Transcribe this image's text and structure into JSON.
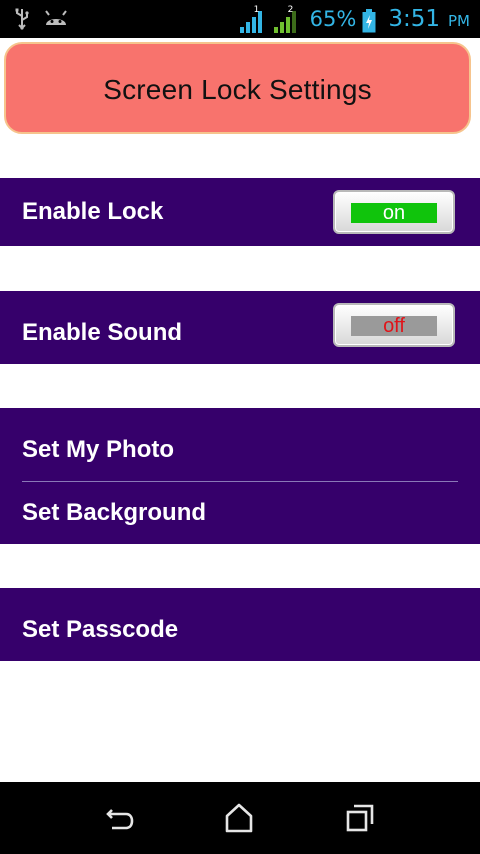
{
  "status_bar": {
    "icons_left": [
      "usb-icon",
      "android-debug-icon"
    ],
    "sim1_label": "1",
    "sim2_label": "2",
    "battery_percent": "65%",
    "time": "3:51",
    "ampm": "PM",
    "colors": {
      "accent": "#33b5e5",
      "sim2_signal": "#6fbf2f"
    }
  },
  "header": {
    "title": "Screen Lock Settings",
    "colors": {
      "background": "#f8736d",
      "border": "#f6c48d"
    }
  },
  "settings": {
    "enable_lock": {
      "label": "Enable Lock",
      "toggle_text": "on",
      "enabled": true
    },
    "enable_sound": {
      "label": "Enable Sound",
      "toggle_text": "off",
      "enabled": false
    },
    "set_my_photo": {
      "label": "Set My Photo"
    },
    "set_background": {
      "label": "Set Background"
    },
    "set_passcode": {
      "label": "Set Passcode"
    },
    "colors": {
      "card_background": "#36006b",
      "toggle_on": "#10c40c",
      "toggle_off": "#9a9a9a",
      "off_text": "#e0141a"
    }
  },
  "nav_bar": {
    "buttons": [
      "back-icon",
      "home-icon",
      "recent-apps-icon"
    ]
  }
}
